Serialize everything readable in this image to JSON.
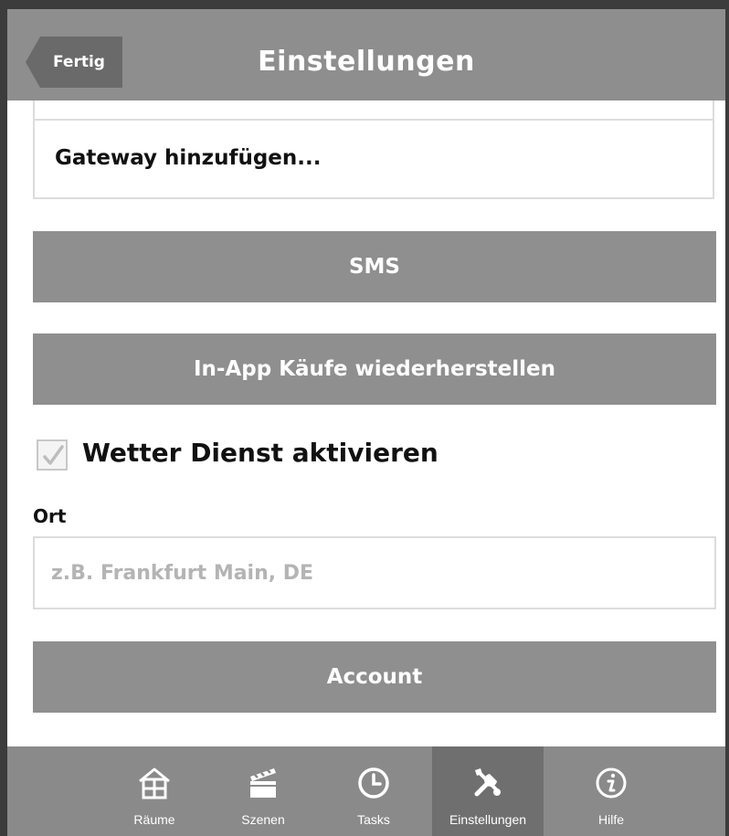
{
  "header": {
    "back_label": "Fertig",
    "title": "Einstellungen"
  },
  "settings": {
    "gateway_add_label": "Gateway hinzufügen...",
    "sms_button": "SMS",
    "restore_purchases_button": "In-App Käufe wiederherstellen",
    "weather_label": "Wetter Dienst aktivieren",
    "weather_checked": true,
    "location_label": "Ort",
    "location_value": "",
    "location_placeholder": "z.B. Frankfurt Main, DE",
    "account_button": "Account"
  },
  "tabbar": {
    "active": "Einstellungen",
    "tabs": [
      {
        "label": "Räume",
        "icon": "house-icon"
      },
      {
        "label": "Szenen",
        "icon": "clapperboard-icon"
      },
      {
        "label": "Tasks",
        "icon": "clock-icon"
      },
      {
        "label": "Einstellungen",
        "icon": "tools-icon"
      },
      {
        "label": "Hilfe",
        "icon": "info-icon"
      }
    ]
  },
  "colors": {
    "header_bg": "#8e8e8e",
    "button_bg": "#8f8f8f",
    "tabbar_bg": "#8a8a8a",
    "tab_active_bg": "#6f6f6f"
  }
}
